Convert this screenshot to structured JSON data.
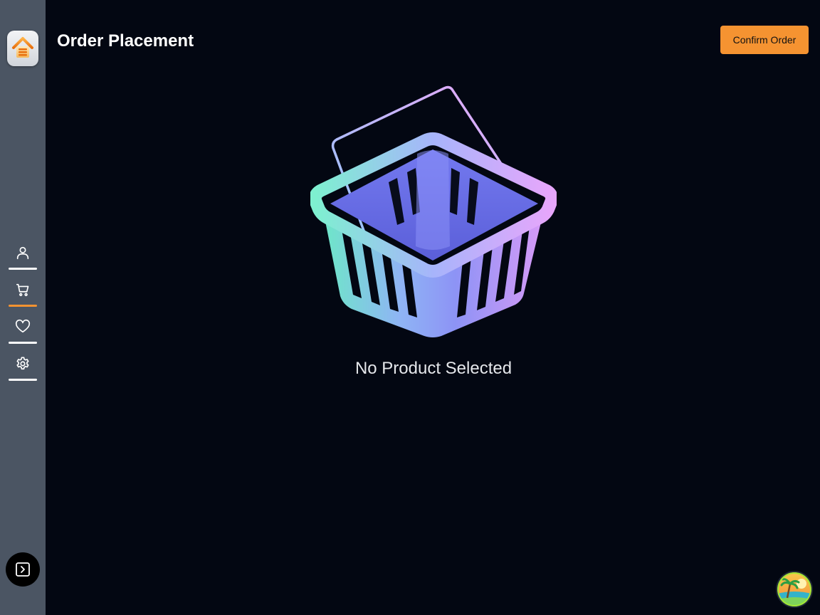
{
  "header": {
    "title": "Order Placement",
    "confirm_label": "Confirm Order"
  },
  "sidebar": {
    "logo": "home-logo-icon",
    "items": [
      {
        "name": "profile",
        "icon": "user-icon",
        "active": false
      },
      {
        "name": "cart",
        "icon": "cart-icon",
        "active": true
      },
      {
        "name": "favorites",
        "icon": "heart-icon",
        "active": false
      },
      {
        "name": "settings",
        "icon": "gear-icon",
        "active": false
      }
    ],
    "expand_icon": "expand-panel-icon"
  },
  "main": {
    "empty_illustration": "basket-icon",
    "empty_message": "No Product Selected"
  },
  "user": {
    "avatar_icon": "beach-avatar"
  },
  "colors": {
    "accent": "#f59331",
    "background": "#030712",
    "sidebar": "#4b5563",
    "text": "#ffffff"
  }
}
